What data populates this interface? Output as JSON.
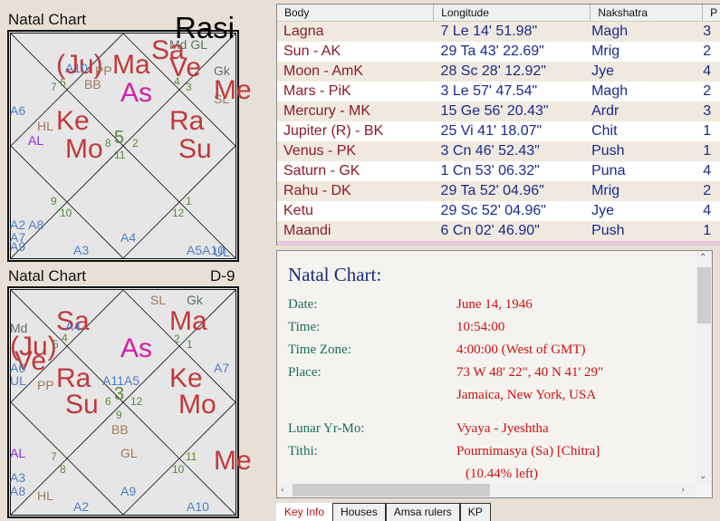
{
  "rasi": {
    "title": "Natal Chart",
    "division": "Rasi",
    "labels": [
      "Md GL",
      "Sa",
      "(Ju)",
      "A10",
      "PP",
      "Ma",
      "Ve",
      "Gk",
      "7",
      "6",
      "BB",
      "As",
      "4",
      "3",
      "Me",
      "SL",
      "A6",
      "HL",
      "Ke",
      "AL",
      "Mo",
      "5",
      "8",
      "2",
      "11",
      "Ra",
      "Su",
      "9",
      "10",
      "1",
      "12",
      "A2 A8",
      "A7",
      "A9",
      "A4",
      "A3",
      "A5A10",
      "UL"
    ]
  },
  "navamsa": {
    "title": "Natal Chart",
    "division": "D-9",
    "labels": [
      "SL",
      "Gk",
      "Sa",
      "A4",
      "Md",
      "Ma",
      "(Ju)",
      "Ve",
      "5",
      "4",
      "2",
      "1",
      "As",
      "A6",
      "UL",
      "A7",
      "PP",
      "Ra",
      "A11A5",
      "Ke",
      "3",
      "6",
      "12",
      "9",
      "Su",
      "Mo",
      "BB",
      "AL",
      "GL",
      "7",
      "8",
      "11",
      "10",
      "Me",
      "A3",
      "A8",
      "HL",
      "A9",
      "A2",
      "A10"
    ]
  },
  "table": {
    "headers": [
      "Body",
      "Longitude",
      "Nakshatra",
      "P"
    ],
    "rows": [
      [
        "Lagna",
        "7 Le 14' 51.98\"",
        "Magh",
        "3"
      ],
      [
        "Sun - AK",
        "29 Ta 43' 22.69\"",
        "Mrig",
        "2"
      ],
      [
        "Moon - AmK",
        "28 Sc 28' 12.92\"",
        "Jye",
        "4"
      ],
      [
        "Mars - PiK",
        "3 Le 57' 47.54\"",
        "Magh",
        "2"
      ],
      [
        "Mercury - MK",
        "15 Ge 56' 20.43\"",
        "Ardr",
        "3"
      ],
      [
        "Jupiter (R) - BK",
        "25 Vi 41' 18.07\"",
        "Chit",
        "1"
      ],
      [
        "Venus - PK",
        "3 Cn 46' 52.43\"",
        "Push",
        "1"
      ],
      [
        "Saturn - GK",
        "1 Cn 53' 06.32\"",
        "Puna",
        "4"
      ],
      [
        "Rahu - DK",
        "29 Ta 52' 04.96\"",
        "Mrig",
        "2"
      ],
      [
        "Ketu",
        "29 Sc 52' 04.96\"",
        "Jye",
        "4"
      ],
      [
        "Maandi",
        "6 Cn 02' 46.90\"",
        "Push",
        "1"
      ]
    ]
  },
  "info": {
    "title": "Natal Chart:",
    "rows": [
      {
        "label": "Date:",
        "value": "June 14, 1946"
      },
      {
        "label": "Time:",
        "value": "10:54:00"
      },
      {
        "label": "Time Zone:",
        "value": "4:00:00 (West of GMT)"
      },
      {
        "label": "Place:",
        "value": "73 W 48' 22\", 40 N 41' 29\""
      },
      {
        "label": "",
        "value": "Jamaica, New York, USA"
      },
      {
        "label": "Lunar Yr-Mo:",
        "value": "Vyaya - Jyeshtha"
      },
      {
        "label": "Tithi:",
        "value": "Pournimasya (Sa) [Chitra]"
      },
      {
        "label": "",
        "value": "(10.44% left)"
      }
    ]
  },
  "tabs": [
    "Key Info",
    "Houses",
    "Amsa rulers",
    "KP"
  ],
  "colors": {
    "planet": "#c0393b",
    "ascendant": "#d21fa8",
    "arudha": "#4f7fc8",
    "value": "#cc1111",
    "label": "#1d6b5c"
  }
}
